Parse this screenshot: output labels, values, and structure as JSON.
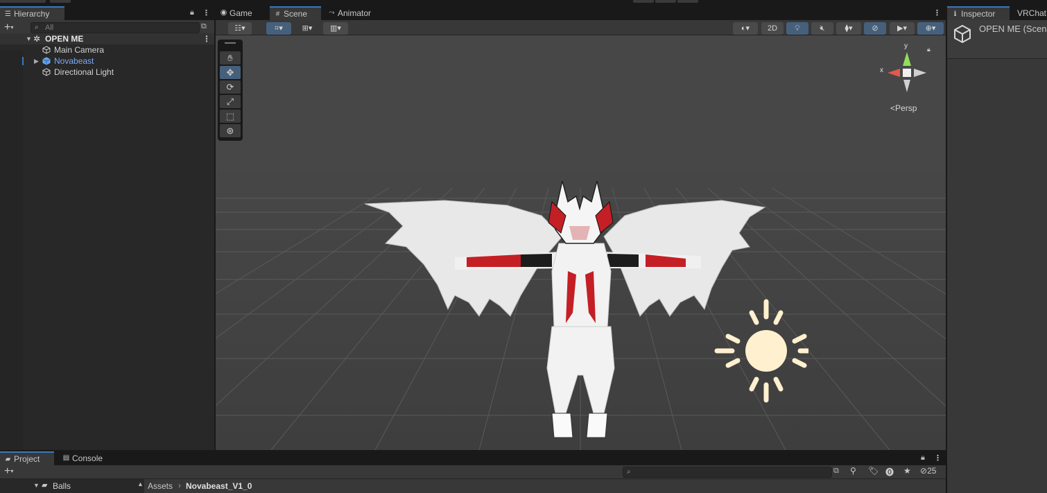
{
  "hierarchy": {
    "tab_label": "Hierarchy",
    "search_placeholder": "All",
    "scene_name": "OPEN ME",
    "items": [
      {
        "label": "Main Camera",
        "selected": false
      },
      {
        "label": "Novabeast",
        "selected": false,
        "is_prefab": true
      },
      {
        "label": "Directional Light",
        "selected": false
      }
    ]
  },
  "scene_view": {
    "tabs": [
      {
        "label": "Game",
        "icon": "gamepad-icon"
      },
      {
        "label": "Scene",
        "icon": "grid-icon",
        "active": true
      },
      {
        "label": "Animator",
        "icon": "animator-icon"
      }
    ],
    "toggle_2d_label": "2D",
    "gizmo": {
      "y_label": "y",
      "x_label": "x",
      "projection_label": "Persp"
    }
  },
  "inspector": {
    "tabs": [
      {
        "label": "Inspector",
        "icon": "info-icon",
        "active": true
      },
      {
        "label": "VRChat"
      }
    ],
    "title": "OPEN ME (Scen"
  },
  "project": {
    "tabs": [
      {
        "label": "Project",
        "icon": "folder-icon",
        "active": true
      },
      {
        "label": "Console",
        "icon": "console-icon"
      }
    ],
    "folder_tree_item": "Balls",
    "breadcrumb": [
      "Assets",
      "Novabeast_V1_0"
    ],
    "hidden_count": "25"
  },
  "colors": {
    "accent": "#3a79bb",
    "prefab_text": "#7baaf7",
    "viewport_bg": "#474747",
    "light_icon": "#fff0cf"
  }
}
